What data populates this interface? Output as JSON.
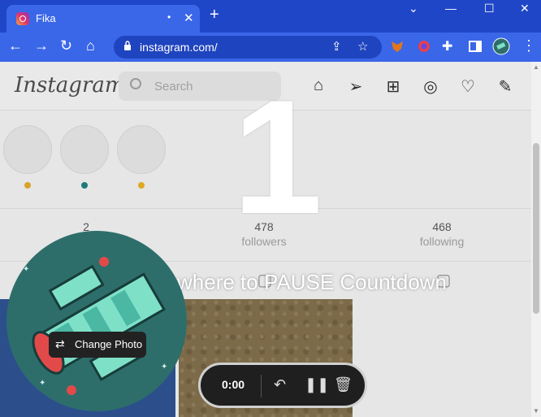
{
  "browser": {
    "tab_title": "Fika",
    "url": "instagram.com/",
    "new_tab_symbol": "+",
    "tab_close_symbol": "✕",
    "tab_dot_symbol": "•"
  },
  "instagram": {
    "logo": "Instagram",
    "search_placeholder": "Search",
    "nav_icons": [
      "home-icon",
      "direct-icon",
      "new-post-icon",
      "explore-icon",
      "activity-icon",
      "profile-icon"
    ],
    "stats": [
      {
        "num": "2",
        "label": ""
      },
      {
        "num": "478",
        "label": "followers"
      },
      {
        "num": "468",
        "label": "following"
      }
    ]
  },
  "overlay": {
    "countdown": "1",
    "message": "where to PAUSE Countdown",
    "change_photo_label": "Change Photo"
  },
  "recorder": {
    "time": "0:00"
  },
  "colors": {
    "tab_bar": "#2046c8",
    "toolbar": "#3a66e8",
    "avatar_bg": "#2d6e6b"
  }
}
